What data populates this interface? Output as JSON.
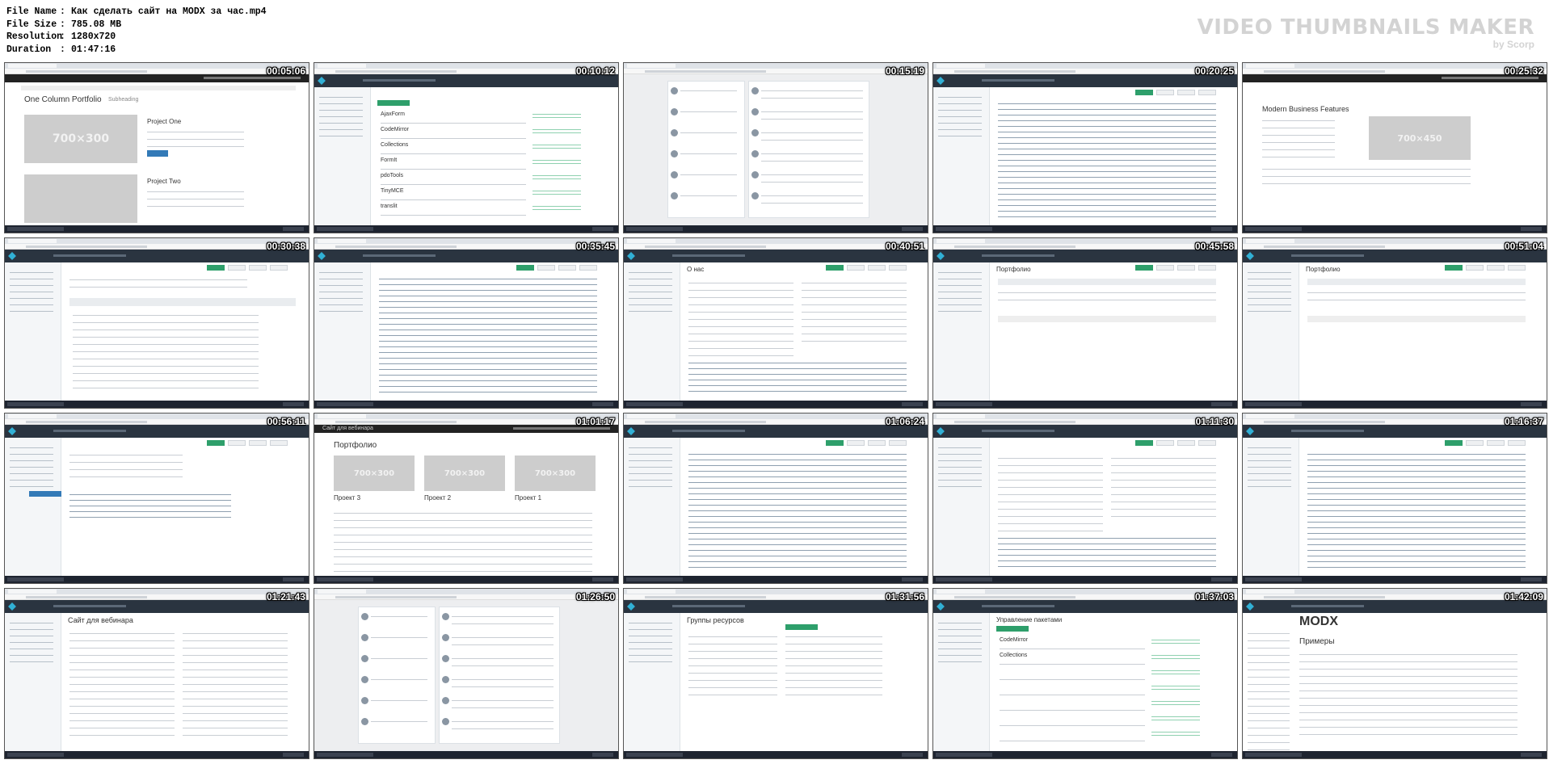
{
  "file_info": {
    "rows": [
      {
        "key": "File Name",
        "value": "Как сделать сайт на MODX за час.mp4"
      },
      {
        "key": "File Size",
        "value": "785.08 MB"
      },
      {
        "key": "Resolution",
        "value": "1280x720"
      },
      {
        "key": "Duration",
        "value": "01:47:16"
      }
    ],
    "separator": ":"
  },
  "brand": {
    "title": "VIDEO THUMBNAILS MAKER",
    "subtitle": "by Scorp"
  },
  "thumbnails": [
    {
      "timestamp": "00:05:06",
      "kind": "website",
      "title": "One Column Portfolio",
      "subtitle": "Subheading",
      "placeholder": "700×300",
      "project": "Project One",
      "project2": "Project Two"
    },
    {
      "timestamp": "00:10:12",
      "kind": "modx-list",
      "items": [
        "AjaxForm",
        "CodeMirror",
        "Collections",
        "FormIt",
        "pdoTools",
        "TinyMCE",
        "translit"
      ]
    },
    {
      "timestamp": "00:15:19",
      "kind": "vk"
    },
    {
      "timestamp": "00:20:25",
      "kind": "modx-code"
    },
    {
      "timestamp": "00:25:32",
      "kind": "website",
      "title": "Modern Business Features",
      "placeholder": "700×450"
    },
    {
      "timestamp": "00:30:38",
      "kind": "modx-editor"
    },
    {
      "timestamp": "00:35:45",
      "kind": "modx-code"
    },
    {
      "timestamp": "00:40:51",
      "kind": "modx-form",
      "title": "О нас"
    },
    {
      "timestamp": "00:45:58",
      "kind": "modx-grid",
      "title": "Портфолио"
    },
    {
      "timestamp": "00:51:04",
      "kind": "modx-grid",
      "title": "Портфолио"
    },
    {
      "timestamp": "00:56:11",
      "kind": "modx-tree"
    },
    {
      "timestamp": "01:01:17",
      "kind": "website-portfolio",
      "site_title": "Сайт для вебинара",
      "title": "Портфолио",
      "placeholder": "700×300",
      "projects": [
        "Проект 3",
        "Проект 2",
        "Проект 1"
      ]
    },
    {
      "timestamp": "01:06:24",
      "kind": "modx-code"
    },
    {
      "timestamp": "01:11:30",
      "kind": "modx-form"
    },
    {
      "timestamp": "01:16:37",
      "kind": "modx-code"
    },
    {
      "timestamp": "01:21:43",
      "kind": "modx-dashboard",
      "title": "Сайт для вебинара"
    },
    {
      "timestamp": "01:26:50",
      "kind": "vk"
    },
    {
      "timestamp": "01:31:56",
      "kind": "modx-groups",
      "title": "Группы ресурсов"
    },
    {
      "timestamp": "01:37:03",
      "kind": "modx-packages",
      "title": "Управление пакетами",
      "items": [
        "CodeMirror",
        "Collections"
      ]
    },
    {
      "timestamp": "01:42:09",
      "kind": "modx-docs",
      "logo": "MODX",
      "title": "Примеры"
    }
  ],
  "colors": {
    "modx_header": "#2a3440",
    "modx_green": "#2e9f6b",
    "placeholder": "#cdcdcd",
    "brand": "#d3d3d3"
  }
}
